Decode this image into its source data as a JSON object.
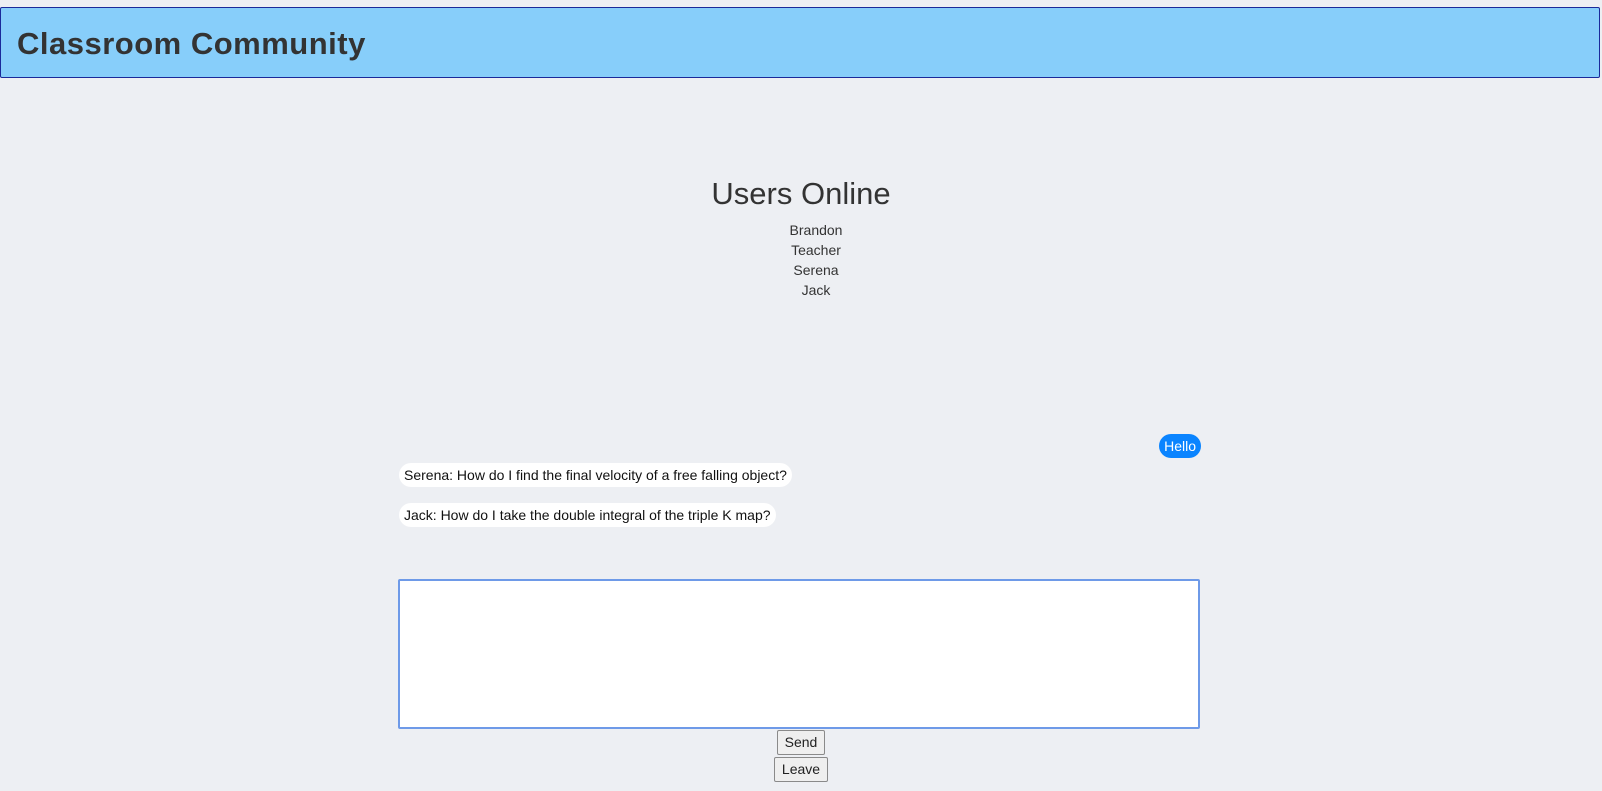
{
  "app": {
    "title": "Classroom Community"
  },
  "users_online": {
    "title": "Users Online",
    "users": [
      "Brandon",
      "Teacher",
      "Serena",
      "Jack"
    ]
  },
  "chat": {
    "messages": [
      {
        "text": "Hello",
        "own": true
      },
      {
        "text": "Serena: How do I find the final velocity of a free falling object?",
        "own": false
      },
      {
        "text": "Jack: How do I take the double integral of the triple K map?",
        "own": false
      }
    ]
  },
  "composer": {
    "value": "",
    "send_label": "Send",
    "leave_label": "Leave"
  },
  "colors": {
    "header_bg": "#87cefa",
    "page_bg": "#edeff3",
    "own_bubble": "#0a84ff",
    "other_bubble": "#ffffff",
    "input_border": "#6e9ae8"
  }
}
